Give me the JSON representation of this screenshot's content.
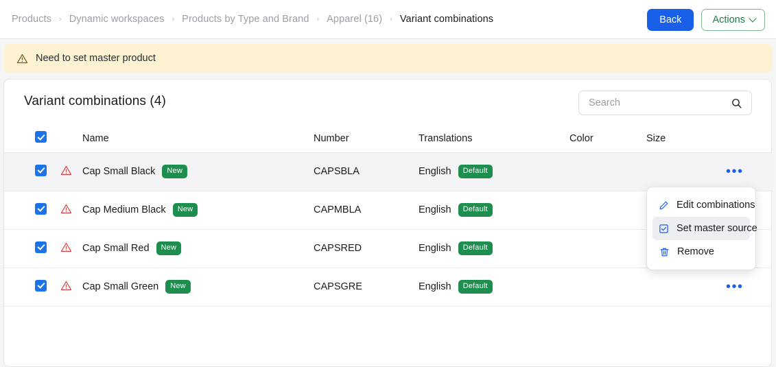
{
  "topbar": {
    "breadcrumb": [
      {
        "label": "Products"
      },
      {
        "label": "Dynamic workspaces"
      },
      {
        "label": "Products by Type and Brand"
      },
      {
        "label": "Apparel (16)"
      },
      {
        "label": "Variant combinations"
      }
    ],
    "separator": "›",
    "back_label": "Back",
    "actions_label": "Actions"
  },
  "banner": {
    "message": "Need to set master product",
    "icon": "warning-triangle-icon",
    "bg_color": "#fdf3d2"
  },
  "card": {
    "title": "Variant combinations (4)",
    "search": {
      "placeholder": "Search",
      "value": "",
      "icon": "search-icon"
    },
    "table": {
      "columns": [
        "Name",
        "Number",
        "Translations",
        "Color",
        "Size"
      ],
      "rows": [
        {
          "checked": true,
          "warning": true,
          "name": "Cap Small Black",
          "name_badge": "New",
          "number": "CAPSBLA",
          "translation": "English",
          "translation_badge": "Default",
          "color": "",
          "size": ""
        },
        {
          "checked": true,
          "warning": true,
          "name": "Cap Medium Black",
          "name_badge": "New",
          "number": "CAPMBLA",
          "translation": "English",
          "translation_badge": "Default",
          "color": "",
          "size": ""
        },
        {
          "checked": true,
          "warning": true,
          "name": "Cap Small Red",
          "name_badge": "New",
          "number": "CAPSRED",
          "translation": "English",
          "translation_badge": "Default",
          "color": "",
          "size": ""
        },
        {
          "checked": true,
          "warning": true,
          "name": "Cap Small Green",
          "name_badge": "New",
          "number": "CAPSGRE",
          "translation": "English",
          "translation_badge": "Default",
          "color": "",
          "size": ""
        }
      ]
    }
  },
  "row_menu": {
    "items": [
      {
        "label": "Edit combinations",
        "icon": "pencil-icon",
        "hovered": false
      },
      {
        "label": "Set master source",
        "icon": "checkbox-icon",
        "hovered": true
      },
      {
        "label": "Remove",
        "icon": "trash-icon",
        "hovered": false
      }
    ]
  },
  "colors": {
    "primary_blue": "#1a5fe8",
    "checkbox_blue": "#1a73e8",
    "badge_green": "#1e8e4e",
    "action_green": "#1e7d45",
    "warning_red": "#d64545",
    "banner_yellow": "#fdf3d2"
  }
}
